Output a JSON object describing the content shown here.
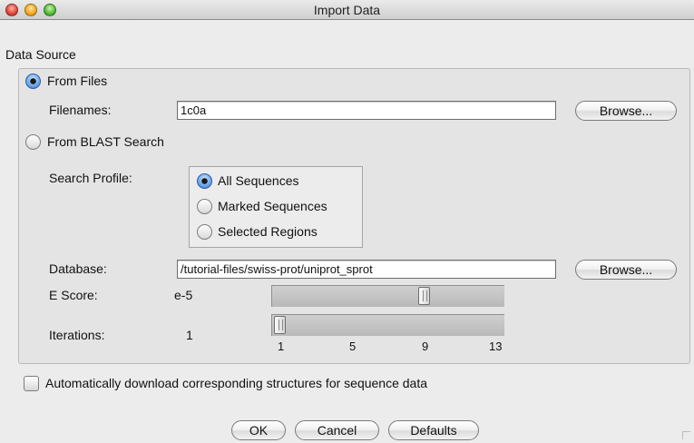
{
  "window": {
    "title": "Import Data"
  },
  "data_source": {
    "heading": "Data Source",
    "from_files": {
      "label": "From Files",
      "selected": true
    },
    "filenames_label": "Filenames:",
    "filenames_value": "1c0a",
    "browse_label": "Browse...",
    "from_blast": {
      "label": "From BLAST Search",
      "selected": false
    },
    "search_profile_label": "Search Profile:",
    "search_profile_options": [
      {
        "label": "All Sequences",
        "selected": true
      },
      {
        "label": "Marked Sequences",
        "selected": false
      },
      {
        "label": "Selected Regions",
        "selected": false
      }
    ],
    "database_label": "Database:",
    "database_value": "/tutorial-files/swiss-prot/uniprot_sprot",
    "database_browse_label": "Browse...",
    "escore_label": "E Score:",
    "escore_value": "e-5",
    "escore_slider_fraction": 0.66,
    "iterations_label": "Iterations:",
    "iterations_value": "1",
    "iterations_slider_fraction": 0.0,
    "iterations_ticks": [
      "1",
      "5",
      "9",
      "13"
    ]
  },
  "auto_download": {
    "label": "Automatically download corresponding structures for sequence data",
    "checked": false
  },
  "footer": {
    "ok_label": "OK",
    "cancel_label": "Cancel",
    "defaults_label": "Defaults"
  }
}
